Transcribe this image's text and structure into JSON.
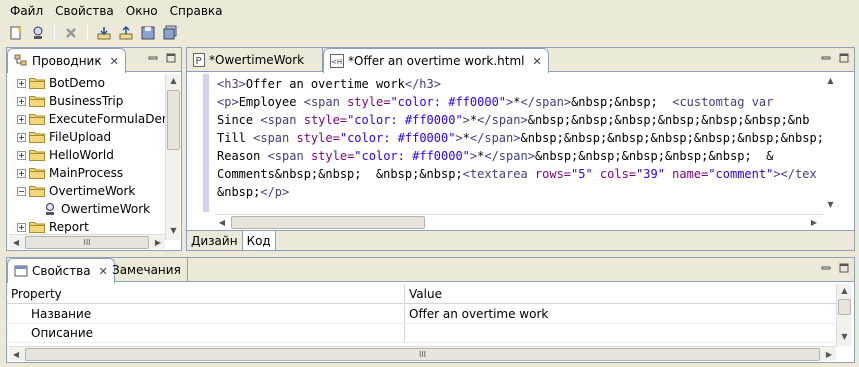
{
  "menu": [
    "Файл",
    "Свойства",
    "Окно",
    "Справка"
  ],
  "explorer": {
    "tab_label": "Проводник",
    "items": [
      {
        "label": "BotDemo",
        "expanded": false
      },
      {
        "label": "BusinessTrip",
        "expanded": false
      },
      {
        "label": "ExecuteFormulaDem",
        "expanded": false
      },
      {
        "label": "FileUpload",
        "expanded": false
      },
      {
        "label": "HelloWorld",
        "expanded": false
      },
      {
        "label": "MainProcess",
        "expanded": false
      },
      {
        "label": "OvertimeWork",
        "expanded": true
      },
      {
        "label": "OwertimeWork",
        "child": true
      },
      {
        "label": "Report",
        "expanded": false
      }
    ],
    "scroll_center_glyph": "III"
  },
  "editor": {
    "tabs": [
      {
        "label": "*OwertimeWork",
        "icon": "process-file-icon"
      },
      {
        "label": "*Offer an overtime work.html",
        "icon": "html-file-icon"
      }
    ],
    "lines": [
      [
        [
          "tg",
          "<h3>"
        ],
        [
          "tx",
          "Offer an overtime work"
        ],
        [
          "tg",
          "</h3>"
        ]
      ],
      [
        [
          "tg",
          "<p>"
        ],
        [
          "tx",
          "Employee "
        ],
        [
          "tg",
          "<span "
        ],
        [
          "at",
          "style="
        ],
        [
          "av",
          "\"color: #ff0000\""
        ],
        [
          "tg",
          ">"
        ],
        [
          "tx",
          "*"
        ],
        [
          "tg",
          "</span>"
        ],
        [
          "tx",
          "&nbsp;&nbsp;  "
        ],
        [
          "tg",
          "<customtag var"
        ]
      ],
      [
        [
          "tx",
          "Since "
        ],
        [
          "tg",
          "<span "
        ],
        [
          "at",
          "style="
        ],
        [
          "av",
          "\"color: #ff0000\""
        ],
        [
          "tg",
          ">"
        ],
        [
          "tx",
          "*"
        ],
        [
          "tg",
          "</span>"
        ],
        [
          "tx",
          "&nbsp;&nbsp;&nbsp;&nbsp;&nbsp;&nbsp;&nb"
        ]
      ],
      [
        [
          "tx",
          "Till "
        ],
        [
          "tg",
          "<span "
        ],
        [
          "at",
          "style="
        ],
        [
          "av",
          "\"color: #ff0000\""
        ],
        [
          "tg",
          ">"
        ],
        [
          "tx",
          "*"
        ],
        [
          "tg",
          "</span>"
        ],
        [
          "tx",
          "&nbsp;&nbsp;&nbsp;&nbsp;&nbsp;&nbsp;&nbsp;"
        ]
      ],
      [
        [
          "tx",
          "Reason "
        ],
        [
          "tg",
          "<span "
        ],
        [
          "at",
          "style="
        ],
        [
          "av",
          "\"color: #ff0000\""
        ],
        [
          "tg",
          ">"
        ],
        [
          "tx",
          "*"
        ],
        [
          "tg",
          "</span>"
        ],
        [
          "tx",
          "&nbsp;&nbsp;&nbsp;&nbsp;&nbsp;  &"
        ]
      ],
      [
        [
          "tx",
          "Comments&nbsp;&nbsp;  &nbsp;&nbsp;"
        ],
        [
          "tg",
          "<textarea "
        ],
        [
          "at",
          "rows="
        ],
        [
          "av",
          "\"5\" "
        ],
        [
          "at",
          "cols="
        ],
        [
          "av",
          "\"39\" "
        ],
        [
          "at",
          "name="
        ],
        [
          "av",
          "\"comment\""
        ],
        [
          "tg",
          "></tex"
        ]
      ],
      [
        [
          "tx",
          "&nbsp;"
        ],
        [
          "tg",
          "</p>"
        ]
      ]
    ],
    "bottom_tabs": [
      "Дизайн",
      "Код"
    ]
  },
  "properties": {
    "tabs": [
      "Свойства",
      "Замечания"
    ],
    "header": {
      "property": "Property",
      "value": "Value"
    },
    "rows": [
      {
        "property": "Название",
        "value": "Offer an overtime work"
      },
      {
        "property": "Описание",
        "value": ""
      }
    ],
    "scroll_center_glyph": "III"
  }
}
